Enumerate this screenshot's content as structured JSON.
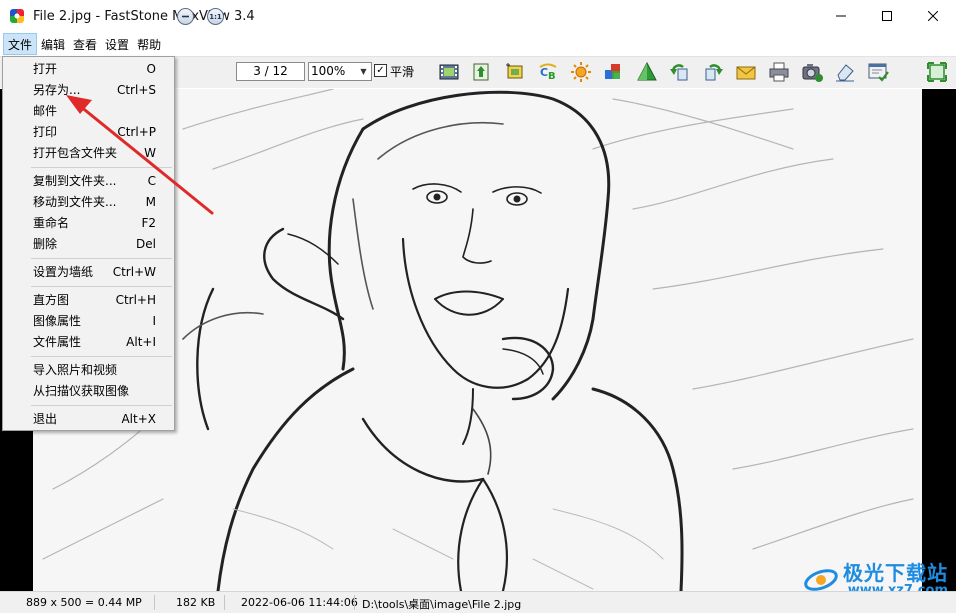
{
  "window": {
    "title": "File 2.jpg - FastStone MaxView 3.4"
  },
  "menubar": {
    "items": [
      "文件",
      "编辑",
      "查看",
      "设置",
      "帮助"
    ],
    "active": "文件"
  },
  "toolbar": {
    "nav_buttons": [
      "prev-icon",
      "fit-icon"
    ],
    "actual_size_label": "1:1",
    "page_indicator": "3 / 12",
    "zoom_value": "100%",
    "smooth_checked": true,
    "smooth_label": "平滑",
    "icons": [
      "slideshow-icon",
      "resize-icon",
      "crop-icon",
      "color-balance-icon",
      "brightness-icon",
      "effects-icon",
      "sharpen-icon",
      "rotate-left-icon",
      "rotate-right-icon",
      "email-icon",
      "print-icon",
      "screen-capture-icon",
      "eraser-icon",
      "settings-icon",
      "fullscreen-icon"
    ]
  },
  "file_menu": {
    "groups": [
      [
        {
          "label": "打开",
          "shortcut": "O"
        },
        {
          "label": "另存为...",
          "shortcut": "Ctrl+S"
        },
        {
          "label": "邮件",
          "shortcut": ""
        },
        {
          "label": "打印",
          "shortcut": "Ctrl+P"
        },
        {
          "label": "打开包含文件夹",
          "shortcut": "W"
        }
      ],
      [
        {
          "label": "复制到文件夹...",
          "shortcut": "C"
        },
        {
          "label": "移动到文件夹...",
          "shortcut": "M"
        },
        {
          "label": "重命名",
          "shortcut": "F2"
        },
        {
          "label": "删除",
          "shortcut": "Del"
        }
      ],
      [
        {
          "label": "设置为墙纸",
          "shortcut": "Ctrl+W"
        }
      ],
      [
        {
          "label": "直方图",
          "shortcut": "Ctrl+H"
        },
        {
          "label": "图像属性",
          "shortcut": "I"
        },
        {
          "label": "文件属性",
          "shortcut": "Alt+I"
        }
      ],
      [
        {
          "label": "导入照片和视频",
          "shortcut": ""
        },
        {
          "label": "从扫描仪获取图像",
          "shortcut": ""
        }
      ],
      [
        {
          "label": "退出",
          "shortcut": "Alt+X"
        }
      ]
    ]
  },
  "statusbar": {
    "dimensions": "889 x 500 = 0.44 MP",
    "file_size": "182 KB",
    "date": "2022-06-06 11:44:06",
    "path": "D:\\tools\\桌面\\image\\File 2.jpg"
  },
  "watermark": {
    "name": "极光下载站",
    "url": "www.xz7.com"
  },
  "colors": {
    "menu_highlight": "#cce4f7",
    "annotation_arrow": "#e02a2a",
    "watermark": "#1e8ce0"
  }
}
